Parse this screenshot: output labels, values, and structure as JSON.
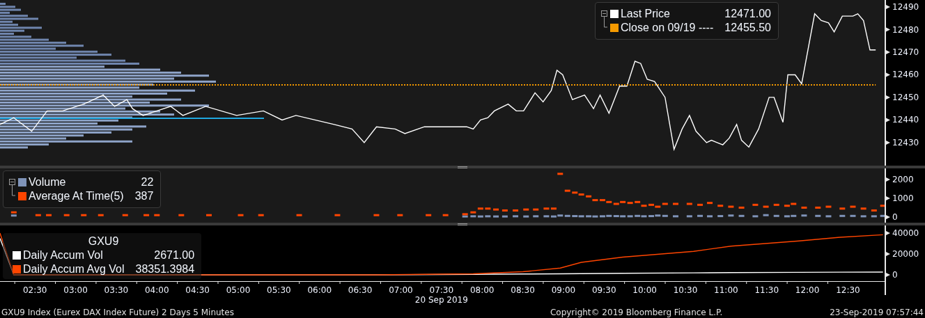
{
  "price_panel": {
    "legend_values": [
      "12471.00",
      "12455.50"
    ],
    "chart_data": {
      "type": "line",
      "legend": "upper right",
      "xlim": [
        2.07,
        12.95
      ],
      "ylim": [
        12419.8,
        12493.1
      ],
      "yticks": [
        12430,
        12440,
        12450,
        12460,
        12470,
        12480,
        12490
      ],
      "x": [
        2.07,
        2.24,
        2.46,
        2.65,
        2.84,
        3.1,
        3.34,
        3.48,
        3.63,
        3.7,
        3.83,
        4.0,
        4.17,
        4.32,
        4.6,
        4.98,
        5.31,
        5.54,
        5.71,
        6.18,
        6.4,
        6.55,
        6.7,
        6.93,
        7.05,
        7.29,
        7.55,
        7.81,
        7.89,
        7.98,
        8.07,
        8.15,
        8.32,
        8.42,
        8.51,
        8.65,
        8.75,
        8.85,
        8.92,
        8.99,
        9.11,
        9.26,
        9.37,
        9.45,
        9.56,
        9.69,
        9.78,
        9.88,
        9.95,
        10.03,
        10.12,
        10.25,
        10.36,
        10.46,
        10.55,
        10.63,
        10.76,
        10.82,
        10.89,
        10.96,
        11.04,
        11.13,
        11.19,
        11.28,
        11.4,
        11.53,
        11.59,
        11.7,
        11.76,
        11.85,
        11.93,
        12.09,
        12.17,
        12.26,
        12.33,
        12.43,
        12.56,
        12.62,
        12.69,
        12.77,
        12.84
      ],
      "series": [
        {
          "name": "Last Price",
          "color": "#ffffff",
          "values": [
            12438,
            12441,
            12435,
            12444,
            12444,
            12447,
            12451,
            12446,
            12449,
            12445,
            12442,
            12444,
            12446,
            12442,
            12446,
            12442,
            12444,
            12440,
            12442,
            12438,
            12436,
            12430,
            12437,
            12436,
            12434,
            12437,
            12437,
            12437,
            12436,
            12440,
            12441,
            12444,
            12447,
            12444,
            12444,
            12452,
            12448,
            12453,
            12462,
            12460,
            12449,
            12451,
            12445,
            12451,
            12443,
            12455,
            12455,
            12466,
            12465,
            12458,
            12457,
            12450,
            12427,
            12436,
            12442,
            12435,
            12430,
            12431,
            12430,
            12429,
            12432,
            12438,
            12431,
            12428,
            12436,
            12450,
            12450,
            12439,
            12460,
            12460,
            12456,
            12487,
            12484,
            12483,
            12479,
            12486,
            12486,
            12487,
            12484,
            12471,
            12471
          ]
        },
        {
          "name": "Close on 09/19 ----",
          "color": "#f59a00",
          "line_style": "dotted",
          "values": [
            12455.5,
            12455.5,
            12455.5,
            12455.5,
            12455.5,
            12455.5,
            12455.5,
            12455.5,
            12455.5,
            12455.5,
            12455.5,
            12455.5,
            12455.5,
            12455.5,
            12455.5,
            12455.5,
            12455.5,
            12455.5,
            12455.5,
            12455.5,
            12455.5,
            12455.5,
            12455.5,
            12455.5,
            12455.5,
            12455.5,
            12455.5,
            12455.5,
            12455.5,
            12455.5,
            12455.5,
            12455.5,
            12455.5,
            12455.5,
            12455.5,
            12455.5,
            12455.5,
            12455.5,
            12455.5,
            12455.5,
            12455.5,
            12455.5,
            12455.5,
            12455.5,
            12455.5,
            12455.5,
            12455.5,
            12455.5,
            12455.5,
            12455.5,
            12455.5,
            12455.5,
            12455.5,
            12455.5,
            12455.5,
            12455.5,
            12455.5,
            12455.5,
            12455.5,
            12455.5,
            12455.5,
            12455.5,
            12455.5,
            12455.5,
            12455.5,
            12455.5,
            12455.5,
            12455.5,
            12455.5,
            12455.5,
            12455.5,
            12455.5,
            12455.5,
            12455.5,
            12455.5,
            12455.5,
            12455.5,
            12455.5,
            12455.5,
            12455.5,
            12455.5
          ]
        }
      ]
    }
  },
  "volume_panel": {
    "legend_values": [
      "22",
      "387"
    ],
    "chart_data": {
      "type": "scatter",
      "legend": "upper left",
      "xlim": [
        2.07,
        12.95
      ],
      "ylim": [
        -300,
        2590
      ],
      "yticks": [
        0,
        1000,
        2000
      ],
      "x": [
        2.24,
        2.54,
        2.67,
        2.89,
        3.1,
        3.31,
        3.61,
        3.87,
        4.0,
        4.3,
        4.64,
        5.03,
        5.28,
        5.75,
        6.22,
        6.7,
        6.99,
        7.34,
        7.55,
        7.79,
        7.89,
        7.98,
        8.07,
        8.17,
        8.28,
        8.41,
        8.54,
        8.66,
        8.79,
        8.88,
        8.96,
        9.05,
        9.14,
        9.22,
        9.31,
        9.39,
        9.48,
        9.56,
        9.65,
        9.73,
        9.82,
        9.91,
        9.99,
        10.08,
        10.16,
        10.25,
        10.38,
        10.55,
        10.68,
        10.8,
        10.93,
        11.06,
        11.19,
        11.36,
        11.49,
        11.62,
        11.75,
        11.83,
        11.96,
        12.13,
        12.26,
        12.43,
        12.56,
        12.69,
        12.82,
        12.93
      ],
      "series": [
        {
          "name": "Volume",
          "color": "#7f93b8",
          "values": [
            80,
            null,
            null,
            null,
            null,
            null,
            null,
            null,
            null,
            null,
            null,
            null,
            null,
            null,
            null,
            null,
            null,
            null,
            null,
            30,
            40,
            30,
            40,
            30,
            30,
            40,
            30,
            40,
            40,
            30,
            80,
            60,
            50,
            40,
            40,
            30,
            40,
            60,
            50,
            40,
            40,
            60,
            40,
            50,
            80,
            60,
            40,
            40,
            60,
            40,
            50,
            80,
            60,
            40,
            100,
            60,
            40,
            60,
            80,
            60,
            40,
            60,
            60,
            40,
            40,
            60
          ]
        },
        {
          "name": "Average At Time(5)",
          "color": "#ff4500",
          "values": [
            250,
            100,
            100,
            100,
            100,
            100,
            100,
            100,
            100,
            100,
            100,
            100,
            100,
            100,
            100,
            100,
            100,
            100,
            100,
            150,
            250,
            450,
            450,
            400,
            350,
            350,
            400,
            400,
            450,
            450,
            2300,
            1400,
            1300,
            1200,
            1100,
            900,
            900,
            800,
            700,
            800,
            750,
            800,
            600,
            650,
            550,
            700,
            700,
            700,
            650,
            750,
            600,
            550,
            500,
            650,
            550,
            650,
            600,
            700,
            500,
            500,
            550,
            450,
            550,
            450,
            350,
            600
          ]
        }
      ]
    }
  },
  "accum_panel": {
    "legend_title": "GXU9",
    "legend_values": [
      "2671.00",
      "38351.3984"
    ],
    "chart_data": {
      "type": "line",
      "legend": "lower left",
      "xlim": [
        2.07,
        12.95
      ],
      "ylim": [
        -6000,
        47300
      ],
      "yticks": [
        0,
        20000,
        40000
      ],
      "xticks": [
        {
          "value": 2.5,
          "label": "02:30"
        },
        {
          "value": 3.0,
          "label": "03:00"
        },
        {
          "value": 3.5,
          "label": "03:30"
        },
        {
          "value": 4.0,
          "label": "04:00"
        },
        {
          "value": 4.5,
          "label": "04:30"
        },
        {
          "value": 5.0,
          "label": "05:00"
        },
        {
          "value": 5.5,
          "label": "05:30"
        },
        {
          "value": 6.0,
          "label": "06:00"
        },
        {
          "value": 6.5,
          "label": "06:30"
        },
        {
          "value": 7.0,
          "label": "07:00"
        },
        {
          "value": 7.5,
          "label": "07:30"
        },
        {
          "value": 8.0,
          "label": "08:00"
        },
        {
          "value": 8.5,
          "label": "08:30"
        },
        {
          "value": 9.0,
          "label": "09:00"
        },
        {
          "value": 9.5,
          "label": "09:30"
        },
        {
          "value": 10.0,
          "label": "10:00"
        },
        {
          "value": 10.5,
          "label": "10:30"
        },
        {
          "value": 11.0,
          "label": "11:00"
        },
        {
          "value": 11.5,
          "label": "11:30"
        },
        {
          "value": 12.0,
          "label": "12:00"
        },
        {
          "value": 12.5,
          "label": "12:30"
        }
      ],
      "xlabel": "20 Sep 2019",
      "x": [
        2.07,
        2.24,
        6.7,
        7.89,
        8.5,
        8.96,
        9.22,
        9.73,
        10.6,
        11.06,
        11.9,
        12.4,
        12.93
      ],
      "series": [
        {
          "name": "Daily Accum Vol",
          "color": "#ffffff",
          "values": [
            35000,
            0,
            0,
            500,
            800,
            1000,
            1200,
            1500,
            1900,
            2100,
            2400,
            2600,
            2671
          ]
        },
        {
          "name": "Daily Accum Avg Vol",
          "color": "#ff4500",
          "values": [
            40000,
            0,
            0,
            1000,
            3000,
            6500,
            12000,
            17000,
            22500,
            27500,
            32500,
            36000,
            38351
          ]
        }
      ]
    }
  },
  "footer": {
    "description": "GXU9 Index (Eurex DAX Index Future) 2 Days 5 Minutes",
    "copyright": "Copyright© 2019 Bloomberg Finance L.P.",
    "timestamp": "23-Sep-2019 07:57:44"
  }
}
